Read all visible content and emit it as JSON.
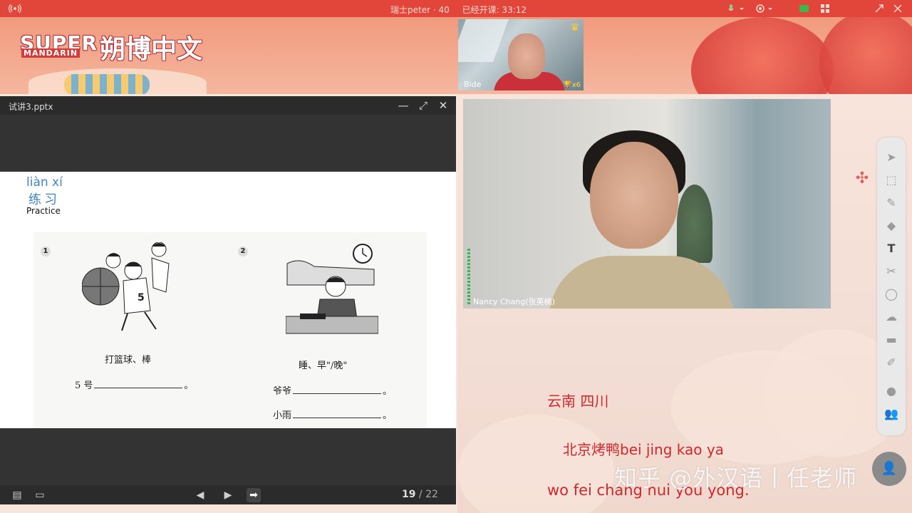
{
  "topbar": {
    "class_name": "瑞士peter · 40",
    "elapsed": "已经开课: 33:12"
  },
  "logo": {
    "super": "SUPER",
    "mandarin": "MANDARIN",
    "chinese": "朔博中文"
  },
  "small_video": {
    "name": "Bide",
    "trophies": "x6"
  },
  "ppt": {
    "filename": "试讲3.pptx",
    "page_current": "19",
    "page_sep": " / ",
    "page_total": "22"
  },
  "slide": {
    "pinyin": "liàn xí",
    "hanzi": "练习",
    "english": "Practice"
  },
  "workbook": {
    "item1": {
      "num": "1",
      "caption": "打篮球、棒",
      "subject": "5 号",
      "end": "。"
    },
    "item2": {
      "num": "2",
      "caption": "睡、早\"/晚\"",
      "line1": "爷爷",
      "line2": "小雨",
      "end": "。"
    }
  },
  "main_video": {
    "name": "Nancy Chang(张英楠)"
  },
  "whiteboard": {
    "line1": "云南  四川",
    "line2": "北京烤鸭bei jing kao ya",
    "line3": "wo fei chang hui you yong."
  },
  "watermark": "知乎 @外汉语丨任老师",
  "toolbar": {
    "tools": [
      "pointer",
      "select",
      "pen",
      "eraser",
      "text",
      "scissors",
      "shape",
      "cloud",
      "briefcase",
      "edit",
      "chat",
      "users"
    ]
  },
  "colors": {
    "topbar": "#e2463a",
    "accent_red": "#d3272b",
    "pinyin_blue": "#3e86c3"
  }
}
